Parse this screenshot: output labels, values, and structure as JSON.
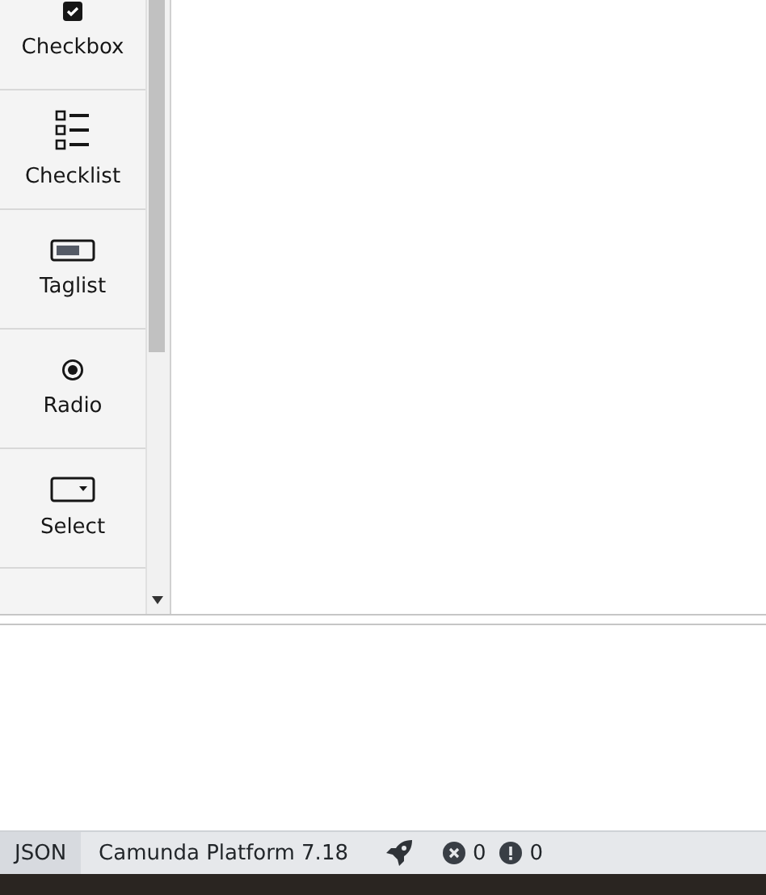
{
  "palette": {
    "items": [
      {
        "kind": "checkbox",
        "label": "Checkbox"
      },
      {
        "kind": "checklist",
        "label": "Checklist"
      },
      {
        "kind": "taglist",
        "label": "Taglist"
      },
      {
        "kind": "radio",
        "label": "Radio"
      },
      {
        "kind": "select",
        "label": "Select"
      }
    ]
  },
  "status_bar": {
    "tab": "JSON",
    "platform": "Camunda Platform 7.18",
    "errors": "0",
    "warnings": "0"
  }
}
